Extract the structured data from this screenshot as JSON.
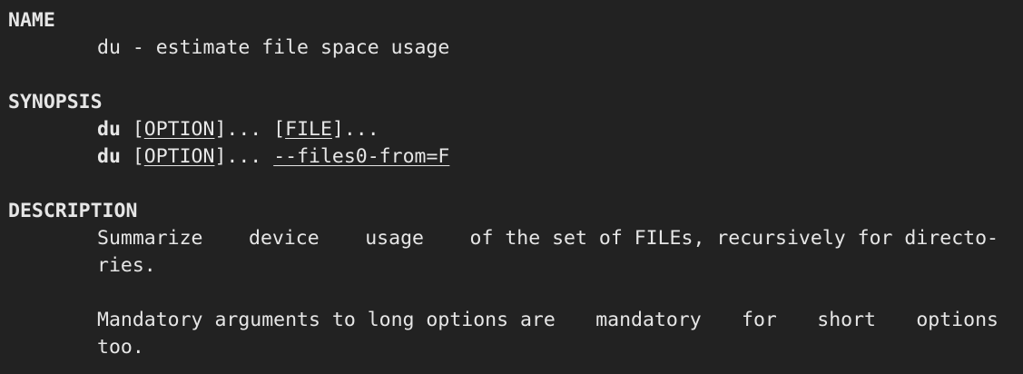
{
  "name": {
    "heading": "NAME",
    "line": "du - estimate file space usage"
  },
  "synopsis": {
    "heading": "SYNOPSIS",
    "line1": {
      "cmd": "du",
      "bracket_open": " [",
      "option": "OPTION",
      "after_option": "]... [",
      "file": "FILE",
      "after_file": "]..."
    },
    "line2": {
      "cmd": "du",
      "bracket_open": " [",
      "option": "OPTION",
      "after_option": "]... ",
      "files0": "--files0-from=F"
    }
  },
  "description": {
    "heading": "DESCRIPTION",
    "para1_line1_words": [
      "Summarize",
      "device",
      "usage",
      "of the set of FILEs, recursively for directo-"
    ],
    "para1_line2": "ries.",
    "para2_line1_words": [
      "Mandatory arguments to long options are",
      "mandatory",
      "for",
      "short",
      "options"
    ],
    "para2_line2": "too."
  }
}
